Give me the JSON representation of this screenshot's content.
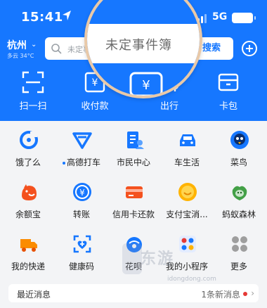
{
  "status": {
    "time": "15:41",
    "network": "5G"
  },
  "location": {
    "city": "杭州",
    "weather": "多云 34°C"
  },
  "search": {
    "placeholder": "未定事件簿",
    "button_label": "搜索",
    "magnified_text": "未定事件簿"
  },
  "quick_actions": [
    {
      "label": "扫一扫",
      "icon": "scan-icon"
    },
    {
      "label": "收付款",
      "icon": "pay-icon"
    },
    {
      "label": "出行",
      "icon": "travel-icon"
    },
    {
      "label": "卡包",
      "icon": "card-wallet-icon"
    }
  ],
  "apps": [
    {
      "label": "饿了么",
      "icon": "eleme-icon"
    },
    {
      "label": "高德打车",
      "icon": "amap-taxi-icon",
      "dot": true
    },
    {
      "label": "市民中心",
      "icon": "citizen-center-icon"
    },
    {
      "label": "车生活",
      "icon": "car-life-icon"
    },
    {
      "label": "菜鸟",
      "icon": "cainiao-icon"
    },
    {
      "label": "余额宝",
      "icon": "yuebao-icon"
    },
    {
      "label": "转账",
      "icon": "transfer-icon"
    },
    {
      "label": "信用卡还款",
      "icon": "credit-card-icon"
    },
    {
      "label": "支付宝消...",
      "icon": "alipay-message-icon"
    },
    {
      "label": "蚂蚁森林",
      "icon": "ant-forest-icon"
    },
    {
      "label": "我的快递",
      "icon": "delivery-truck-icon"
    },
    {
      "label": "健康码",
      "icon": "health-code-icon"
    },
    {
      "label": "花呗",
      "icon": "huabei-icon"
    },
    {
      "label": "我的小程序",
      "icon": "mini-programs-icon"
    },
    {
      "label": "更多",
      "icon": "more-icon"
    }
  ],
  "messages": {
    "title": "最近消息",
    "count_text": "1条新消息",
    "arrow": "›"
  },
  "watermark": {
    "text": "东游",
    "url_text": "idongdong.com"
  },
  "colors": {
    "brand": "#1677ff",
    "background": "#f3f4f6"
  }
}
